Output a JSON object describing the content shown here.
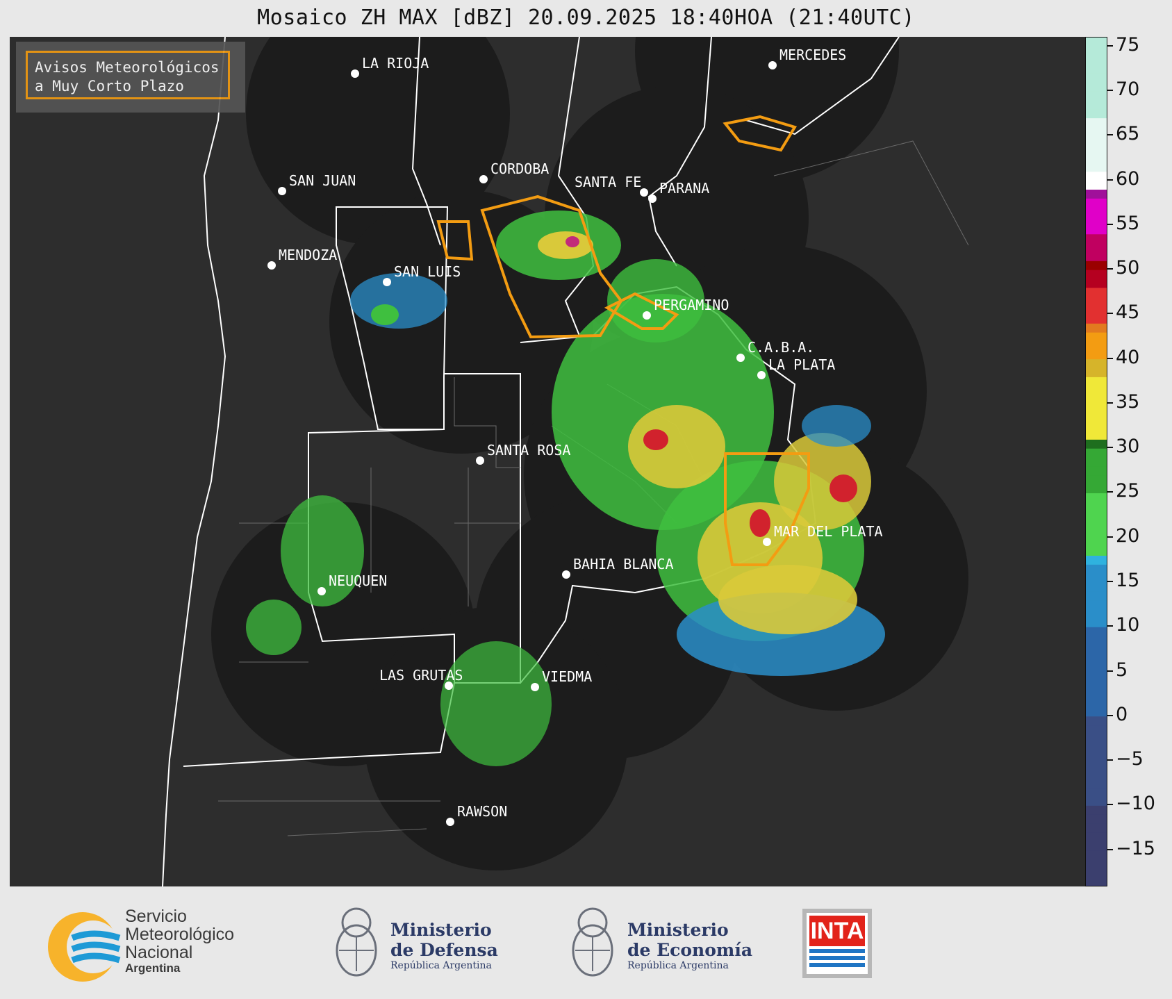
{
  "title": "Mosaico ZH MAX [dBZ] 20.09.2025 18:40HOA (21:40UTC)",
  "legend_box": {
    "line1": "Avisos Meteorológicos",
    "line2": "a Muy Corto Plazo"
  },
  "colorbar": {
    "unit": "dBZ",
    "ticks": [
      "75",
      "70",
      "65",
      "60",
      "55",
      "50",
      "45",
      "40",
      "35",
      "30",
      "25",
      "20",
      "15",
      "10",
      "5",
      "0",
      "−5",
      "−10",
      "−15"
    ],
    "min": -19,
    "max": 76
  },
  "cities": [
    {
      "name": "LA RIOJA"
    },
    {
      "name": "MERCEDES"
    },
    {
      "name": "SAN JUAN"
    },
    {
      "name": "CORDOBA"
    },
    {
      "name": "SANTA FE"
    },
    {
      "name": "PARANA"
    },
    {
      "name": "MENDOZA"
    },
    {
      "name": "SAN LUIS"
    },
    {
      "name": "PERGAMINO"
    },
    {
      "name": "C.A.B.A."
    },
    {
      "name": "LA PLATA"
    },
    {
      "name": "SANTA ROSA"
    },
    {
      "name": "MAR DEL PLATA"
    },
    {
      "name": "BAHIA BLANCA"
    },
    {
      "name": "NEUQUEN"
    },
    {
      "name": "LAS GRUTAS"
    },
    {
      "name": "VIEDMA"
    },
    {
      "name": "RAWSON"
    }
  ],
  "footer": {
    "smn_line1": "Servicio",
    "smn_line2": "Meteorológico",
    "smn_line3": "Nacional",
    "smn_line4": "Argentina",
    "defensa_line1": "Ministerio",
    "defensa_line2": "de Defensa",
    "defensa_line3": "República Argentina",
    "economia_line1": "Ministerio",
    "economia_line2": "de Economía",
    "economia_line3": "República Argentina",
    "inta": "INTA"
  },
  "colors": {
    "map_background": "#2d2d2d",
    "radar_disc": "#1c1c1c",
    "province_border": "#ffffff",
    "warning_polygon": "#f39c12",
    "smn_yellow": "#f7b32b",
    "smn_blue": "#1e9ad6",
    "inta_red": "#e2231a",
    "inta_blue": "#1f75c4"
  }
}
